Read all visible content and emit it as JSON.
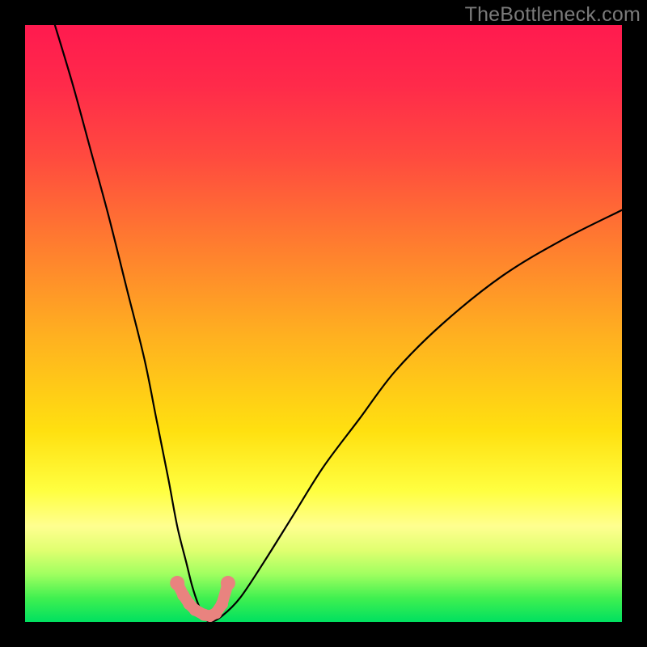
{
  "watermark": "TheBottleneck.com",
  "chart_data": {
    "type": "line",
    "title": "",
    "xlabel": "",
    "ylabel": "",
    "xlim": [
      0,
      100
    ],
    "ylim": [
      0,
      100
    ],
    "series": [
      {
        "name": "bottleneck-curve",
        "x": [
          5,
          8,
          11,
          14,
          17,
          20,
          22,
          24,
          25.5,
          27,
          28,
          29,
          30,
          31,
          33,
          36,
          40,
          45,
          50,
          56,
          62,
          70,
          80,
          90,
          100
        ],
        "values": [
          100,
          90,
          79,
          68,
          56,
          44,
          34,
          24,
          16,
          10,
          6,
          3,
          1,
          0,
          1,
          4,
          10,
          18,
          26,
          34,
          42,
          50,
          58,
          64,
          69
        ]
      }
    ],
    "markers": {
      "name": "highlight-dots",
      "color": "#e9837f",
      "x": [
        25.5,
        26.5,
        27.5,
        28.5,
        30.0,
        31.0,
        32.0,
        33.0,
        34.0
      ],
      "values": [
        6.5,
        4.5,
        3.0,
        2.0,
        1.2,
        1.0,
        1.5,
        3.0,
        6.5
      ]
    },
    "background": {
      "type": "vertical-gradient",
      "top_color": "#ff1a4f",
      "bottom_color": "#00e060"
    }
  }
}
